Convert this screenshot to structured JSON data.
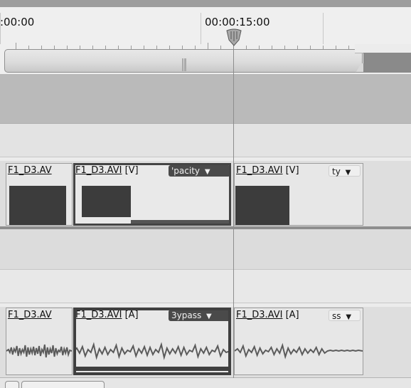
{
  "timeline": {
    "ruler": {
      "left_timecode": ":00:00",
      "center_timecode": "00:00:15:00"
    },
    "video_track": {
      "clips": [
        {
          "name": "F1_D3.AV"
        },
        {
          "name": "F1_D3.AVI",
          "tag": "[V]",
          "property_label": "'pacity"
        },
        {
          "name": "F1_D3.AVI",
          "tag": "[V]",
          "property_label": "ty"
        }
      ]
    },
    "audio_track": {
      "clips": [
        {
          "name": "F1_D3.AV"
        },
        {
          "name": "F1_D3.AVI",
          "tag": "[A]",
          "property_label": "3ypass"
        },
        {
          "name": "F1_D3.AVI",
          "tag": "[A]",
          "property_label": "ss"
        }
      ]
    }
  },
  "icons": {
    "playhead": "playhead-marker-icon",
    "dropdown": "chevron-down-icon",
    "range_handle": "range-handle-icon"
  },
  "colors": {
    "track_background": "#dedede",
    "clip_label_dark": "#4a4a4a",
    "waveform": "#6a6a6a"
  }
}
